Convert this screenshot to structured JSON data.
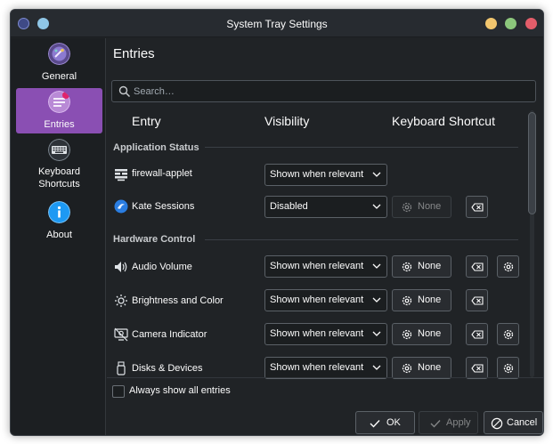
{
  "window": {
    "title": "System Tray Settings"
  },
  "sidebar": {
    "items": [
      {
        "label": "General",
        "icon": "general-icon",
        "active": false
      },
      {
        "label": "Entries",
        "icon": "entries-icon",
        "active": true
      },
      {
        "label": "Keyboard Shortcuts",
        "label_line1": "Keyboard",
        "label_line2": "Shortcuts",
        "icon": "keyboard-icon",
        "active": false
      },
      {
        "label": "About",
        "icon": "info-icon",
        "active": false
      }
    ]
  },
  "main": {
    "heading": "Entries",
    "search": {
      "placeholder": "Search…",
      "value": ""
    },
    "columns": {
      "entry": "Entry",
      "visibility": "Visibility",
      "shortcut": "Keyboard Shortcut"
    },
    "sections": [
      {
        "title": "Application Status",
        "rows": [
          {
            "label": "firewall-applet",
            "icon": "firewall-icon",
            "visibility": "Shown when relevant",
            "shortcut": null,
            "clear_enabled": null,
            "configure": false
          },
          {
            "label": "Kate Sessions",
            "icon": "kate-icon",
            "visibility": "Disabled",
            "shortcut": "None",
            "shortcut_enabled": false,
            "clear_enabled": true,
            "configure": false
          }
        ]
      },
      {
        "title": "Hardware Control",
        "rows": [
          {
            "label": "Audio Volume",
            "icon": "speaker-icon",
            "visibility": "Shown when relevant",
            "shortcut": "None",
            "shortcut_enabled": true,
            "clear_enabled": true,
            "configure": true
          },
          {
            "label": "Brightness and Color",
            "icon": "brightness-icon",
            "visibility": "Shown when relevant",
            "shortcut": "None",
            "shortcut_enabled": true,
            "clear_enabled": true,
            "configure": false
          },
          {
            "label": "Camera Indicator",
            "icon": "camera-icon",
            "visibility": "Shown when relevant",
            "shortcut": "None",
            "shortcut_enabled": true,
            "clear_enabled": true,
            "configure": true
          },
          {
            "label": "Disks & Devices",
            "icon": "usb-icon",
            "visibility": "Shown when relevant",
            "shortcut": "None",
            "shortcut_enabled": true,
            "clear_enabled": true,
            "configure": true
          }
        ]
      }
    ],
    "always_show_all": {
      "label": "Always show all entries",
      "checked": false
    }
  },
  "footer": {
    "ok": "OK",
    "apply": "Apply",
    "cancel": "Cancel"
  },
  "colors": {
    "accent": "#8a4fb3",
    "background": "#202326"
  }
}
